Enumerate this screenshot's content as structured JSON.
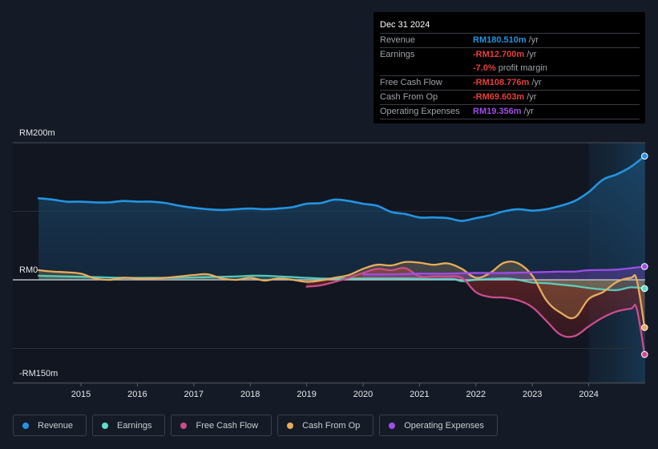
{
  "tooltip": {
    "date": "Dec 31 2024",
    "rows": [
      {
        "label": "Revenue",
        "value": "RM180.510m",
        "unit": "/yr",
        "color": "#2394e1"
      },
      {
        "label": "Earnings",
        "value": "-RM12.700m",
        "unit": "/yr",
        "color": "#e2413d"
      },
      {
        "label": "",
        "value": "-7.0%",
        "unit": "profit margin",
        "color": "#e2413d"
      },
      {
        "label": "Free Cash Flow",
        "value": "-RM108.776m",
        "unit": "/yr",
        "color": "#e2413d"
      },
      {
        "label": "Cash From Op",
        "value": "-RM69.603m",
        "unit": "/yr",
        "color": "#e2413d"
      },
      {
        "label": "Operating Expenses",
        "value": "RM19.356m",
        "unit": "/yr",
        "color": "#9d4ee8"
      }
    ]
  },
  "legend": [
    {
      "label": "Revenue",
      "color": "#2394e1"
    },
    {
      "label": "Earnings",
      "color": "#5de0cc"
    },
    {
      "label": "Free Cash Flow",
      "color": "#cc4c8c"
    },
    {
      "label": "Cash From Op",
      "color": "#e8ac5c"
    },
    {
      "label": "Operating Expenses",
      "color": "#9d4ee8"
    }
  ],
  "chart_data": {
    "type": "line",
    "title": "",
    "xlabel": "",
    "ylabel": "",
    "currency_unit": "RM m",
    "ylim": [
      -150,
      200
    ],
    "y_tick_labels": [
      "RM200m",
      "RM0",
      "-RM150m"
    ],
    "x_tick_labels": [
      "2015",
      "2016",
      "2017",
      "2018",
      "2019",
      "2020",
      "2021",
      "2022",
      "2023",
      "2024"
    ],
    "x_ticks": [
      2015,
      2016,
      2017,
      2018,
      2019,
      2020,
      2021,
      2022,
      2023,
      2024
    ],
    "xlim": [
      2014.25,
      2024.99
    ],
    "grid": true,
    "highlight_region": [
      2024.0,
      2024.99
    ],
    "legend_position": "bottom",
    "series": [
      {
        "name": "Revenue",
        "color": "#2394e1",
        "x": [
          2014.25,
          2014.5,
          2014.75,
          2015.0,
          2015.25,
          2015.5,
          2015.75,
          2016.0,
          2016.25,
          2016.5,
          2016.75,
          2017.0,
          2017.25,
          2017.5,
          2017.75,
          2018.0,
          2018.25,
          2018.5,
          2018.75,
          2019.0,
          2019.25,
          2019.5,
          2019.75,
          2020.0,
          2020.25,
          2020.5,
          2020.75,
          2021.0,
          2021.25,
          2021.5,
          2021.75,
          2022.0,
          2022.25,
          2022.5,
          2022.75,
          2023.0,
          2023.25,
          2023.5,
          2023.75,
          2024.0,
          2024.25,
          2024.5,
          2024.75,
          2024.99
        ],
        "values": [
          119,
          117,
          114,
          114,
          113,
          113,
          115,
          114,
          114,
          112,
          108,
          105,
          103,
          102,
          103,
          104,
          103,
          104,
          106,
          111,
          112,
          117,
          115,
          111,
          108,
          99,
          96,
          91,
          91,
          90,
          86,
          90,
          94,
          100,
          103,
          101,
          103,
          108,
          115,
          128,
          146,
          154,
          165,
          180.5
        ]
      },
      {
        "name": "Earnings",
        "color": "#5de0cc",
        "x": [
          2014.25,
          2014.75,
          2015.25,
          2015.75,
          2016.25,
          2016.75,
          2017.25,
          2017.75,
          2018.0,
          2018.25,
          2018.75,
          2019.25,
          2019.75,
          2020.25,
          2020.75,
          2021.25,
          2021.6,
          2021.75,
          2022.0,
          2022.5,
          2022.75,
          2023.0,
          2023.25,
          2023.5,
          2023.75,
          2024.0,
          2024.25,
          2024.5,
          2024.75,
          2024.99
        ],
        "values": [
          6,
          5,
          4,
          3,
          3,
          3,
          4,
          5,
          6,
          6,
          4,
          2,
          2,
          2,
          2,
          1,
          1,
          -2,
          0,
          2,
          0,
          -4,
          -5,
          -7,
          -9,
          -12,
          -14,
          -15,
          -11,
          -12.7
        ]
      },
      {
        "name": "Free Cash Flow",
        "color": "#cc4c8c",
        "x": [
          2019.0,
          2019.25,
          2019.5,
          2019.75,
          2020.0,
          2020.25,
          2020.5,
          2020.75,
          2021.0,
          2021.25,
          2021.5,
          2021.75,
          2022.0,
          2022.25,
          2022.5,
          2022.75,
          2023.0,
          2023.25,
          2023.5,
          2023.75,
          2024.0,
          2024.25,
          2024.5,
          2024.75,
          2024.85,
          2024.99
        ],
        "values": [
          -10,
          -8,
          -3,
          3,
          10,
          16,
          14,
          17,
          5,
          5,
          5,
          3,
          -18,
          -25,
          -26,
          -30,
          -40,
          -60,
          -80,
          -82,
          -68,
          -55,
          -46,
          -42,
          -42,
          -108.8
        ]
      },
      {
        "name": "Cash From Op",
        "color": "#e8ac5c",
        "x": [
          2014.25,
          2014.5,
          2014.75,
          2015.0,
          2015.25,
          2015.5,
          2015.75,
          2016.0,
          2016.25,
          2016.5,
          2016.75,
          2017.0,
          2017.25,
          2017.5,
          2017.75,
          2018.0,
          2018.25,
          2018.5,
          2018.75,
          2019.0,
          2019.25,
          2019.5,
          2019.75,
          2020.0,
          2020.25,
          2020.5,
          2020.75,
          2021.0,
          2021.25,
          2021.5,
          2021.75,
          2022.0,
          2022.25,
          2022.5,
          2022.75,
          2023.0,
          2023.25,
          2023.5,
          2023.75,
          2024.0,
          2024.25,
          2024.5,
          2024.75,
          2024.85,
          2024.99
        ],
        "values": [
          14,
          12,
          11,
          9,
          2,
          0,
          3,
          2,
          2,
          3,
          5,
          7,
          8,
          2,
          0,
          3,
          -1,
          2,
          0,
          -3,
          -1,
          3,
          7,
          16,
          22,
          21,
          26,
          25,
          22,
          24,
          16,
          3,
          10,
          25,
          24,
          6,
          -30,
          -48,
          -55,
          -28,
          -18,
          -3,
          3,
          0,
          -69.6
        ]
      },
      {
        "name": "Operating Expenses",
        "color": "#9d4ee8",
        "x": [
          2020.0,
          2020.5,
          2021.0,
          2021.5,
          2022.0,
          2022.5,
          2023.0,
          2023.5,
          2023.75,
          2024.0,
          2024.5,
          2024.99
        ],
        "values": [
          8,
          8,
          9,
          9,
          10,
          10,
          11,
          12,
          12,
          14,
          15,
          19.4
        ]
      }
    ]
  }
}
